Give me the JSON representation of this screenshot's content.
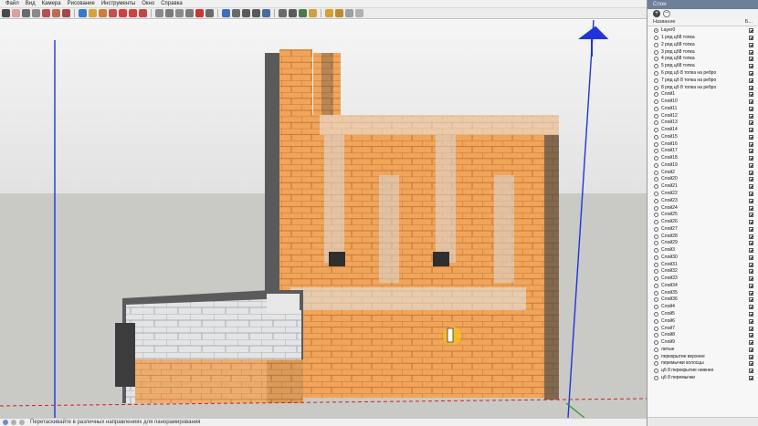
{
  "menu": {
    "items": [
      {
        "label": "Файл"
      },
      {
        "label": "Вид"
      },
      {
        "label": "Камера"
      },
      {
        "label": "Рисование"
      },
      {
        "label": "Инструменты"
      },
      {
        "label": "Окно"
      },
      {
        "label": "Справка"
      }
    ]
  },
  "toolbar": {
    "tools": [
      {
        "icon": "select-arrow-icon",
        "color": "#4a4a4a"
      },
      {
        "icon": "eraser-icon",
        "color": "#d9a0a0"
      },
      {
        "icon": "pencil-icon",
        "color": "#6b6b6b"
      },
      {
        "icon": "arc-icon",
        "color": "#8a8a8a"
      },
      {
        "icon": "rectangle-icon",
        "color": "#b85050"
      },
      {
        "icon": "circle-icon",
        "color": "#c06a50"
      },
      {
        "icon": "polygon-icon",
        "color": "#a04a4a"
      },
      {
        "icon": "sep"
      },
      {
        "icon": "paint-bucket-icon",
        "color": "#3c78c8"
      },
      {
        "icon": "push-pull-icon",
        "color": "#d8a23a"
      },
      {
        "icon": "follow-me-icon",
        "color": "#d27a3a"
      },
      {
        "icon": "offset-icon",
        "color": "#c25050"
      },
      {
        "icon": "move-icon",
        "color": "#d04040"
      },
      {
        "icon": "rotate-icon",
        "color": "#d04040"
      },
      {
        "icon": "scale-icon",
        "color": "#c04848"
      },
      {
        "icon": "sep"
      },
      {
        "icon": "tape-measure-icon",
        "color": "#8a8a8a"
      },
      {
        "icon": "dimension-icon",
        "color": "#7a7a7a"
      },
      {
        "icon": "protractor-icon",
        "color": "#8a8a8a"
      },
      {
        "icon": "text-icon",
        "color": "#7a7a7a"
      },
      {
        "icon": "axes-icon",
        "color": "#cc3333"
      },
      {
        "icon": "3d-text-icon",
        "color": "#6a6a6a"
      },
      {
        "icon": "sep"
      },
      {
        "icon": "orbit-icon",
        "color": "#3a6fbf"
      },
      {
        "icon": "pan-icon",
        "color": "#6a6a6a"
      },
      {
        "icon": "zoom-icon",
        "color": "#5a5a5a"
      },
      {
        "icon": "zoom-window-icon",
        "color": "#5a5a5a"
      },
      {
        "icon": "zoom-extents-icon",
        "color": "#4a6a9a"
      },
      {
        "icon": "sep"
      },
      {
        "icon": "position-camera-icon",
        "color": "#6a6a6a"
      },
      {
        "icon": "walk-icon",
        "color": "#5a5a5a"
      },
      {
        "icon": "look-around-icon",
        "color": "#4a7a4a"
      },
      {
        "icon": "section-plane-icon",
        "color": "#d0a040"
      },
      {
        "icon": "sep"
      },
      {
        "icon": "get-models-icon",
        "color": "#d4a030"
      },
      {
        "icon": "share-model-icon",
        "color": "#c08a30"
      },
      {
        "icon": "components-icon",
        "color": "#a0a0a0"
      },
      {
        "icon": "extension-icon",
        "color": "#b0b0b0"
      }
    ]
  },
  "status": {
    "text": "Перетаскивайте в различных направлениях для панорамирования"
  },
  "panel": {
    "title": "Слои",
    "column_name": "Название",
    "column_visible": "Б...",
    "active_layer": "Layer0",
    "layers": [
      "Layer0",
      "1 ряд цб8 топка",
      "2 ряд цб8 топка",
      "3 ряд цб8 топка",
      "4 ряд цб8 топка",
      "5 ряд цб8 топка",
      "6 ряд цб 8 топка на ребро",
      "7 ряд цб 8 топка на ребро",
      "8 ряд цб 8 топка на ребро",
      "Слой1",
      "Слой10",
      "Слой11",
      "Слой12",
      "Слой13",
      "Слой14",
      "Слой15",
      "Слой16",
      "Слой17",
      "Слой18",
      "Слой19",
      "Слой2",
      "Слой20",
      "Слой21",
      "Слой22",
      "Слой23",
      "Слой24",
      "Слой25",
      "Слой26",
      "Слой27",
      "Слой28",
      "Слой29",
      "Слой3",
      "Слой30",
      "Слой31",
      "Слой32",
      "Слой33",
      "Слой34",
      "Слой35",
      "Слой36",
      "Слой4",
      "Слой5",
      "Слой6",
      "Слой7",
      "Слой8",
      "Слой9",
      "литые",
      "перекрытие верхнее",
      "перемычки колосцы",
      "цб 8 перекрытие нижнее",
      "цб 8 перемычки"
    ]
  },
  "colors": {
    "brick": "#f0a55a",
    "mortar": "#b8682a",
    "stone": "#d7d9dc",
    "dark_brick": "#4a4a4a",
    "sky_top": "#f4f4f4",
    "ground": "#c9c9c6",
    "axis_blue": "#2035d8",
    "axis_red": "#d22222",
    "axis_green": "#2a9a2a"
  }
}
